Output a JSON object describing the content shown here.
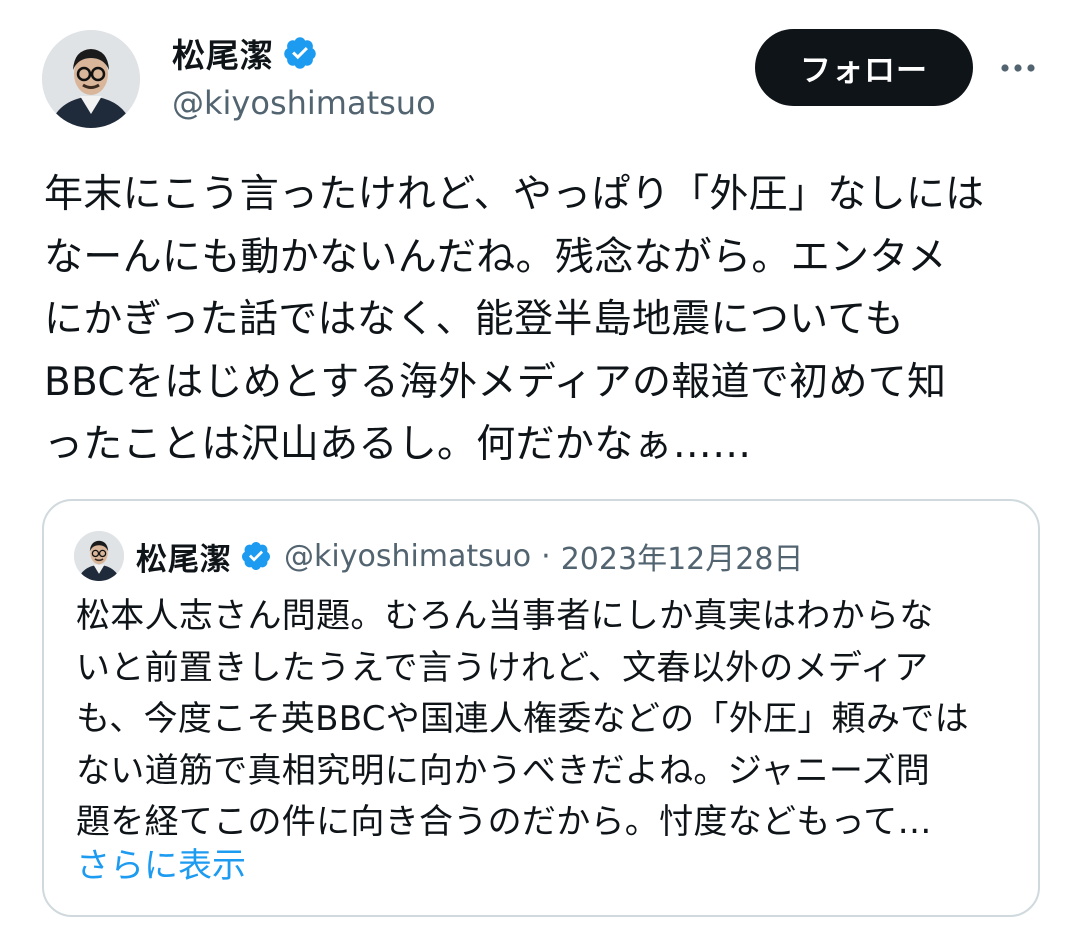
{
  "author": {
    "display_name": "松尾潔",
    "handle": "@kiyoshimatsuo",
    "verified_icon": "verified-badge-icon",
    "verified_color": "#1d9bf0"
  },
  "actions": {
    "follow_label": "フォロー",
    "more_icon": "more-horizontal-icon"
  },
  "tweet": {
    "text": "年末にこう言ったけれど、やっぱり「外圧」なしには\nなーんにも動かないんだね。残念ながら。エンタメ\nにかぎった話ではなく、能登半島地震についても\nBBCをはじめとする海外メディアの報道で初めて知\nったことは沢山あるし。何だかなぁ……"
  },
  "quote": {
    "display_name": "松尾潔",
    "handle": "@kiyoshimatsuo",
    "separator": "·",
    "date": "2023年12月28日",
    "text": "松本人志さん問題。むろん当事者にしか真実はわからな\nいと前置きしたうえで言うけれど、文春以外のメディア\nも、今度こそ英BBCや国連人権委などの「外圧」頼みでは\nない道筋で真相究明に向かうべきだよね。ジャニーズ問\n題を経てこの件に向き合うのだから。忖度などもって…",
    "show_more_label": "さらに表示",
    "link_color": "#1d9bf0"
  }
}
